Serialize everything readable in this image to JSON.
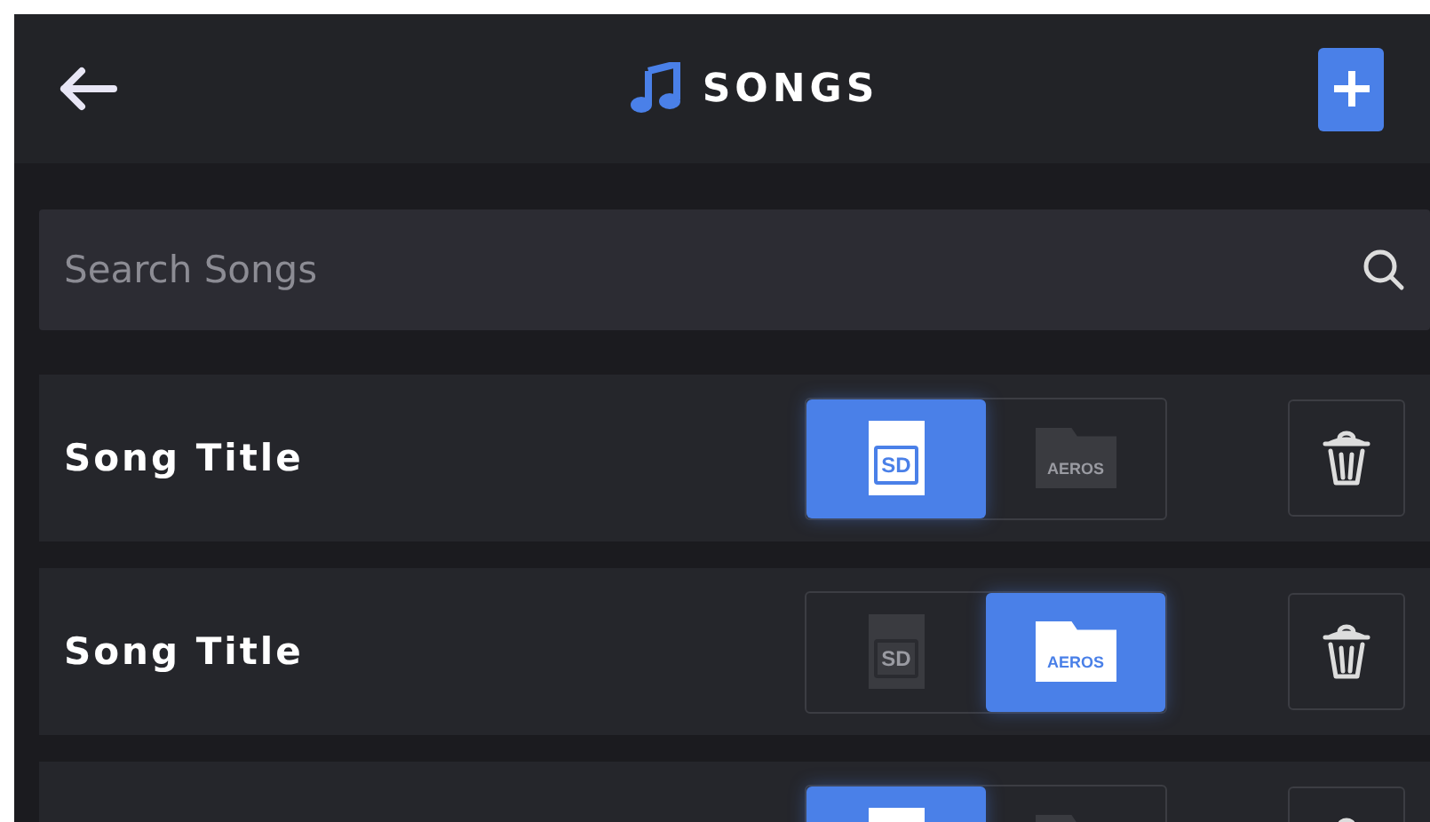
{
  "header": {
    "title": "SONGS"
  },
  "search": {
    "placeholder": "Search Songs"
  },
  "songs": [
    {
      "title": "Song Title",
      "storage": [
        {
          "kind": "sd",
          "label": "SD",
          "selected": true
        },
        {
          "kind": "folder",
          "label": "AEROS",
          "selected": false
        }
      ]
    },
    {
      "title": "Song Title",
      "storage": [
        {
          "kind": "sd",
          "label": "SD",
          "selected": false
        },
        {
          "kind": "folder",
          "label": "AEROS",
          "selected": true
        }
      ]
    },
    {
      "storage": [
        {
          "kind": "sd",
          "selected": true
        },
        {
          "kind": "folder",
          "selected": false
        }
      ]
    }
  ]
}
